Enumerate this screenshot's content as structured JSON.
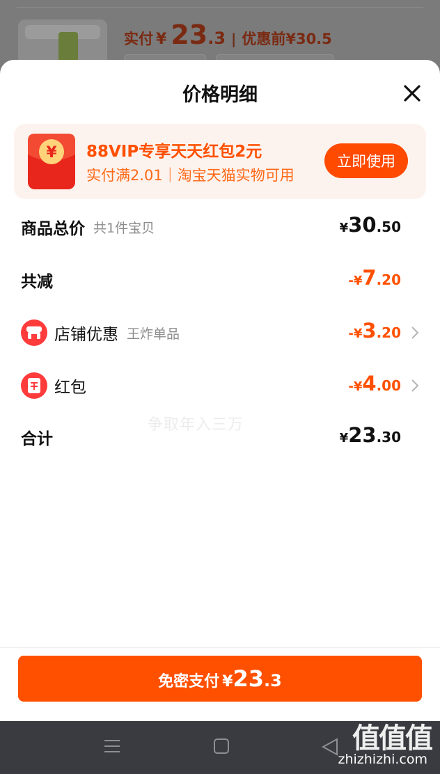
{
  "background": {
    "actual_label": "实付",
    "yen": "¥",
    "actual_int": "23",
    "actual_dec": ".3",
    "separator": "|",
    "original_label": "优惠前",
    "original_price": "¥30.5"
  },
  "sheet": {
    "title": "价格明细",
    "close_icon": "close-icon"
  },
  "promo": {
    "title": "88VIP专享天天红包2元",
    "subtitle": "实付满2.01｜淘宝天猫实物可用",
    "button": "立即使用",
    "icon": "red-envelope-icon",
    "icon_symbol": "¥"
  },
  "rows": {
    "total": {
      "label": "商品总价",
      "hint": "共1件宝贝",
      "yen": "¥",
      "int": "30",
      "dec": ".50"
    },
    "discount": {
      "label": "共减",
      "sign": "-",
      "yen": "¥",
      "int": "7",
      "dec": ".20"
    },
    "shop": {
      "label": "店铺优惠",
      "hint": "王炸单品",
      "sign": "-",
      "yen": "¥",
      "int": "3",
      "dec": ".20",
      "icon": "shop-icon"
    },
    "redpacket": {
      "label": "红包",
      "sign": "-",
      "yen": "¥",
      "int": "4",
      "dec": ".00",
      "icon": "red-envelope-icon"
    },
    "sum": {
      "label": "合计",
      "yen": "¥",
      "int": "23",
      "dec": ".30"
    }
  },
  "watermark_text": "争取年入三万",
  "pay": {
    "label": "免密支付",
    "yen": "¥",
    "int": "23",
    "dec": ".3"
  },
  "navbar": {
    "menu_icon": "menu-icon",
    "home_icon": "home-square-icon",
    "back_icon": "back-triangle-icon"
  },
  "site_watermark": {
    "logo": "值值值",
    "url": "zhizhizhi.com"
  },
  "colors": {
    "accent": "#ff5000",
    "promo_bg": "#fdf3ee",
    "navbar": "#3a3b40"
  }
}
